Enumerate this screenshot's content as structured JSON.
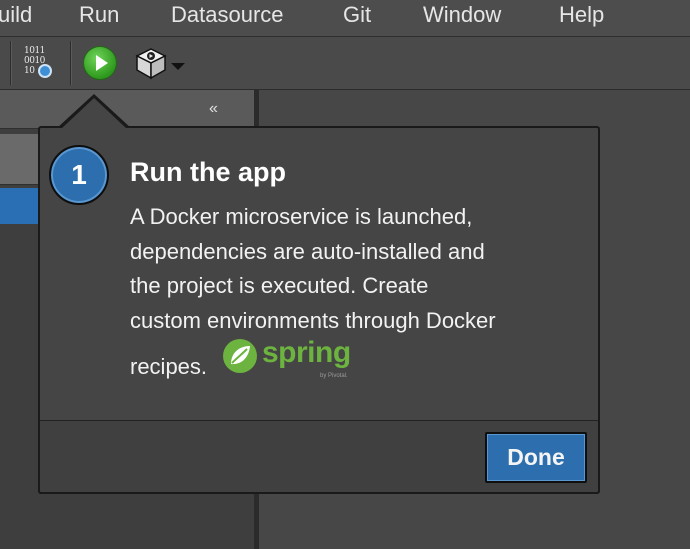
{
  "menu": {
    "items": [
      {
        "label": "uild"
      },
      {
        "label": "Run"
      },
      {
        "label": "Datasource"
      },
      {
        "label": "Git"
      },
      {
        "label": "Window"
      },
      {
        "label": "Help"
      }
    ]
  },
  "toolbar": {
    "binary_icon_lines": [
      "1011",
      "0010",
      "10"
    ],
    "icons": [
      "binary-config-icon",
      "run-icon",
      "docker-cube-icon",
      "chevron-down-icon"
    ]
  },
  "left_panel": {
    "collapse_glyph": "«"
  },
  "popover": {
    "step_number": "1",
    "title": "Run the app",
    "body_lines": [
      "A Docker microservice is launched,",
      "dependencies are auto-installed and",
      "the project is executed. Create",
      "custom environments through Docker",
      "recipes."
    ],
    "logo": {
      "word": "spring",
      "byline": "by Pivotal."
    },
    "done_label": "Done"
  },
  "colors": {
    "accent_blue": "#2d6fae",
    "run_green": "#3cae28",
    "spring_green": "#6db33f"
  }
}
